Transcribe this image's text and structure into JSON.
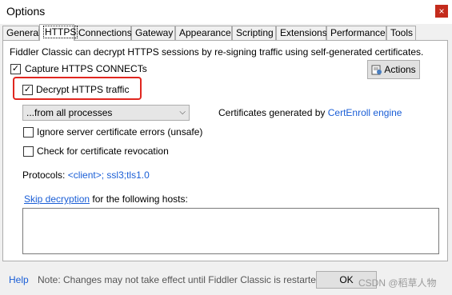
{
  "window": {
    "title": "Options",
    "close_glyph": "×"
  },
  "tabs": [
    {
      "label": "General"
    },
    {
      "label": "HTTPS"
    },
    {
      "label": "Connections"
    },
    {
      "label": "Gateway"
    },
    {
      "label": "Appearance"
    },
    {
      "label": "Scripting"
    },
    {
      "label": "Extensions"
    },
    {
      "label": "Performance"
    },
    {
      "label": "Tools"
    }
  ],
  "active_tab": "HTTPS",
  "https": {
    "intro": "Fiddler Classic can decrypt HTTPS sessions by re-signing traffic using self-generated certificates.",
    "capture_label": "Capture HTTPS CONNECTs",
    "capture_checked": true,
    "actions_label": "Actions",
    "decrypt_label": "Decrypt HTTPS traffic",
    "decrypt_checked": true,
    "process_filter": "...from all processes",
    "cert_prefix": "Certificates generated by",
    "cert_engine": "CertEnroll engine",
    "ignore_errors_label": "Ignore server certificate errors (unsafe)",
    "ignore_errors_checked": false,
    "revocation_label": "Check for certificate revocation",
    "revocation_checked": false,
    "protocols_label": "Protocols:",
    "protocols_value": "<client>; ssl3;tls1.0",
    "skip_link": "Skip decryption",
    "skip_suffix": "for the following hosts:",
    "hosts_value": ""
  },
  "footer": {
    "help": "Help",
    "note": "Note: Changes may not take effect until Fiddler Classic is restarted.",
    "ok": "OK",
    "watermark": "CSDN @稻草人物"
  },
  "colors": {
    "highlight": "#e0261f",
    "link": "#1a5ed6",
    "close": "#c42b1c"
  }
}
